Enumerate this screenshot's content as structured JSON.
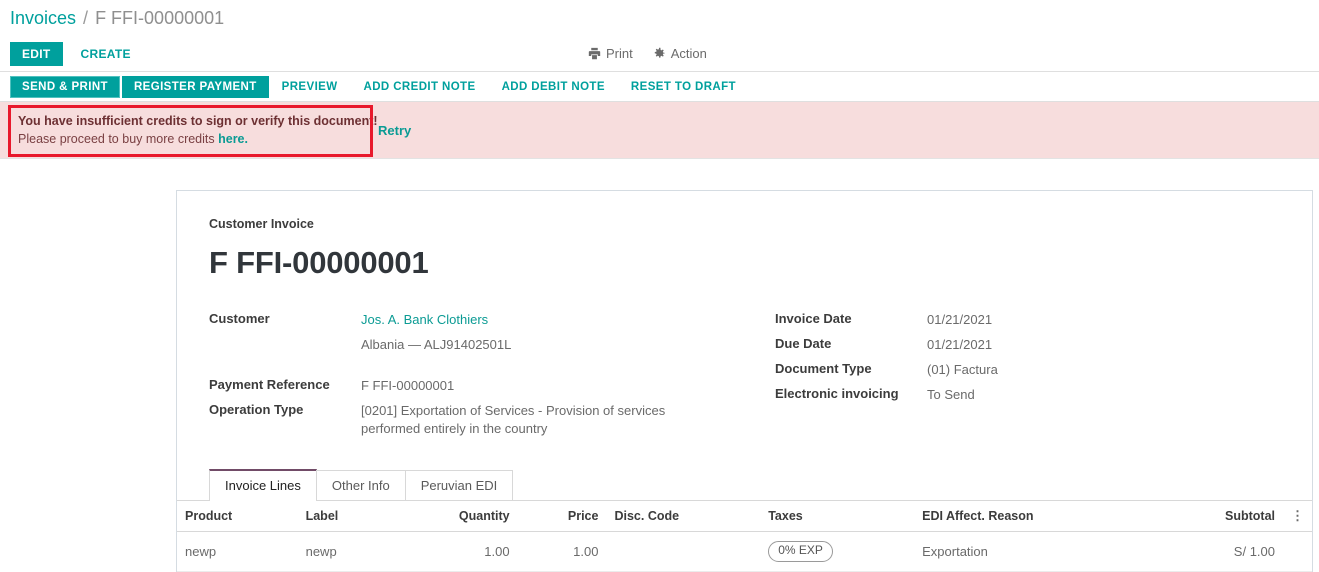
{
  "breadcrumb": {
    "root": "Invoices",
    "separator": "/",
    "current": "F FFI-00000001"
  },
  "action_bar": {
    "edit_label": "EDIT",
    "create_label": "CREATE",
    "print_label": "Print",
    "print_icon": "printer-icon",
    "action_label": "Action",
    "action_icon": "gear-icon"
  },
  "status_buttons": [
    {
      "label": "SEND & PRINT",
      "style": "primary"
    },
    {
      "label": "REGISTER PAYMENT",
      "style": "primary"
    },
    {
      "label": "PREVIEW",
      "style": "flat"
    },
    {
      "label": "ADD CREDIT NOTE",
      "style": "flat"
    },
    {
      "label": "ADD DEBIT NOTE",
      "style": "flat"
    },
    {
      "label": "RESET TO DRAFT",
      "style": "flat"
    }
  ],
  "alert": {
    "title": "You have insufficient credits to sign or verify this document!",
    "body_prefix": "Please proceed to buy more credits ",
    "body_link": "here.",
    "retry_label": "Retry",
    "background_color": "#f7dddd",
    "highlight_color": "#e8192c"
  },
  "invoice": {
    "doc_kind": "Customer Invoice",
    "title": "F FFI-00000001",
    "left_fields": [
      {
        "label": "Customer",
        "value": "Jos. A. Bank Clothiers",
        "is_link": true
      },
      {
        "label": "",
        "value": "Albania — ALJ91402501L",
        "is_link": false
      },
      {
        "label": "Payment Reference",
        "value": "F FFI-00000001",
        "is_link": false
      },
      {
        "label": "Operation Type",
        "value": "[0201] Exportation of Services - Provision of services performed entirely in the country",
        "is_link": false
      }
    ],
    "right_fields": [
      {
        "label": "Invoice Date",
        "value": "01/21/2021"
      },
      {
        "label": "Due Date",
        "value": "01/21/2021"
      },
      {
        "label": "Document Type",
        "value": "(01) Factura"
      },
      {
        "label": "Electronic invoicing",
        "value": "To Send"
      }
    ]
  },
  "tabs": [
    {
      "label": "Invoice Lines",
      "active": true
    },
    {
      "label": "Other Info",
      "active": false
    },
    {
      "label": "Peruvian EDI",
      "active": false
    }
  ],
  "lines_table": {
    "columns": [
      "Product",
      "Label",
      "Quantity",
      "Price",
      "Disc. Code",
      "Taxes",
      "EDI Affect. Reason",
      "Subtotal"
    ],
    "options_icon": "vertical-dots-icon",
    "rows": [
      {
        "product": "newp",
        "label": "newp",
        "quantity": "1.00",
        "price": "1.00",
        "disc_code": "",
        "taxes": "0% EXP",
        "edi_reason": "Exportation",
        "subtotal": "S/ 1.00"
      }
    ]
  },
  "theme": {
    "accent": "#00a09d",
    "tab_accent": "#714b67",
    "link": "#0b9b94"
  }
}
